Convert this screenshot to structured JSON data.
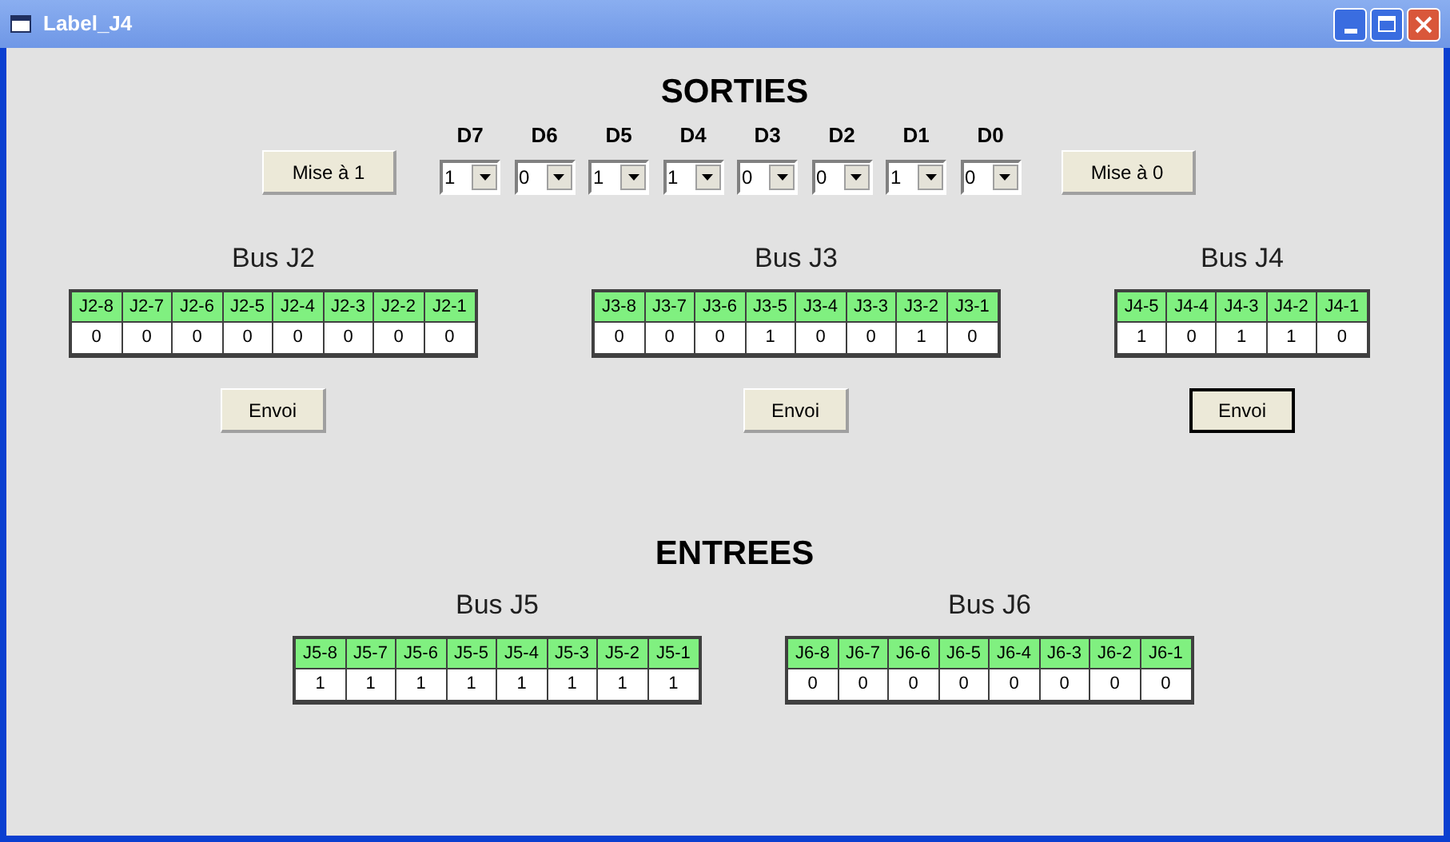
{
  "window": {
    "title": "Label_J4"
  },
  "outputs": {
    "title": "SORTIES",
    "set_button": "Mise à 1",
    "clear_button": "Mise à 0",
    "bits": [
      {
        "label": "D7",
        "value": "1"
      },
      {
        "label": "D6",
        "value": "0"
      },
      {
        "label": "D5",
        "value": "1"
      },
      {
        "label": "D4",
        "value": "1"
      },
      {
        "label": "D3",
        "value": "0"
      },
      {
        "label": "D2",
        "value": "0"
      },
      {
        "label": "D1",
        "value": "1"
      },
      {
        "label": "D0",
        "value": "0"
      }
    ],
    "buses": [
      {
        "title": "Bus J2",
        "pins": [
          "J2-8",
          "J2-7",
          "J2-6",
          "J2-5",
          "J2-4",
          "J2-3",
          "J2-2",
          "J2-1"
        ],
        "values": [
          "0",
          "0",
          "0",
          "0",
          "0",
          "0",
          "0",
          "0"
        ],
        "button": "Envoi",
        "default": false
      },
      {
        "title": "Bus J3",
        "pins": [
          "J3-8",
          "J3-7",
          "J3-6",
          "J3-5",
          "J3-4",
          "J3-3",
          "J3-2",
          "J3-1"
        ],
        "values": [
          "0",
          "0",
          "0",
          "1",
          "0",
          "0",
          "1",
          "0"
        ],
        "button": "Envoi",
        "default": false
      },
      {
        "title": "Bus J4",
        "pins": [
          "J4-5",
          "J4-4",
          "J4-3",
          "J4-2",
          "J4-1"
        ],
        "values": [
          "1",
          "0",
          "1",
          "1",
          "0"
        ],
        "button": "Envoi",
        "default": true
      }
    ]
  },
  "inputs": {
    "title": "ENTREES",
    "buses": [
      {
        "title": "Bus J5",
        "pins": [
          "J5-8",
          "J5-7",
          "J5-6",
          "J5-5",
          "J5-4",
          "J5-3",
          "J5-2",
          "J5-1"
        ],
        "values": [
          "1",
          "1",
          "1",
          "1",
          "1",
          "1",
          "1",
          "1"
        ]
      },
      {
        "title": "Bus J6",
        "pins": [
          "J6-8",
          "J6-7",
          "J6-6",
          "J6-5",
          "J6-4",
          "J6-3",
          "J6-2",
          "J6-1"
        ],
        "values": [
          "0",
          "0",
          "0",
          "0",
          "0",
          "0",
          "0",
          "0"
        ]
      }
    ]
  }
}
